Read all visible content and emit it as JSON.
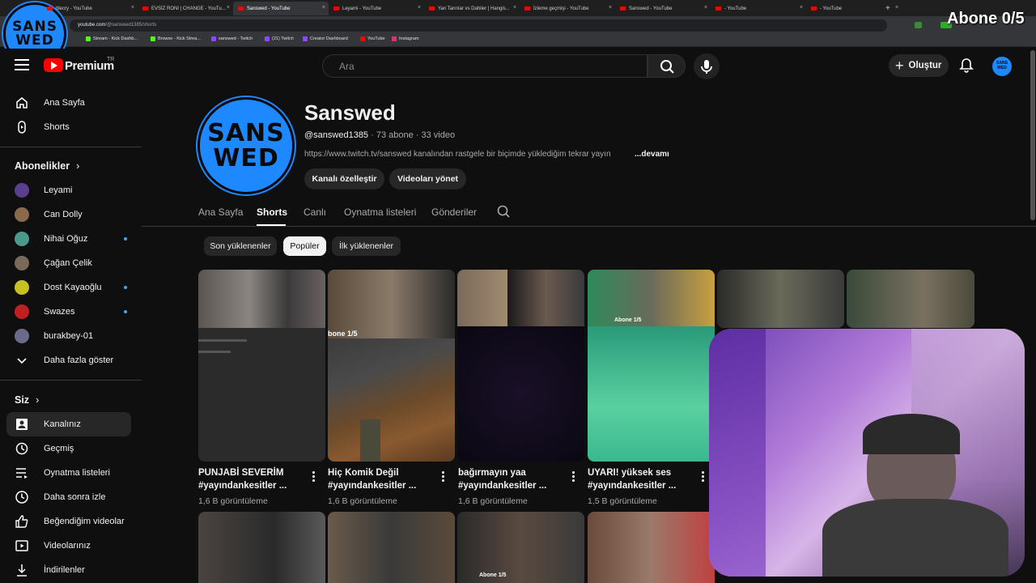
{
  "browser": {
    "tabs": [
      {
        "label": "ttlecry - YouTube",
        "active": false
      },
      {
        "label": "EVSİZ RONI | CHANGE - YouTu...",
        "active": false
      },
      {
        "label": "Sanswed - YouTube",
        "active": true
      },
      {
        "label": "Leyami - YouTube",
        "active": false
      },
      {
        "label": "Yan Tanrılar vs Dahiler | Hangis...",
        "active": false
      },
      {
        "label": "İzleme geçmişi - YouTube",
        "active": false
      },
      {
        "label": "Sanswed - YouTube",
        "active": false
      },
      {
        "label": "- YouTube",
        "active": false
      },
      {
        "label": "- YouTube",
        "active": false
      }
    ],
    "url_host": "youtube.com",
    "url_path": "/@sanswed1385/shorts",
    "bookmarks": [
      {
        "label": "Stream - Kick Dashb...",
        "color": "#53fc18"
      },
      {
        "label": "Browse - Kick Strea...",
        "color": "#53fc18"
      },
      {
        "label": "sanswed - Twitch",
        "color": "#9146ff"
      },
      {
        "label": "(21) Twitch",
        "color": "#9146ff"
      },
      {
        "label": "Creator Dashboard",
        "color": "#9146ff"
      },
      {
        "label": "YouTube",
        "color": "#ff0000"
      },
      {
        "label": "Instagram",
        "color": "#e1306c"
      }
    ]
  },
  "overlay": {
    "logo_line1": "SANS",
    "logo_line2": "WED",
    "abone_counter": "Abone 0/5"
  },
  "header": {
    "brand": "Premium",
    "region": "TR",
    "search_placeholder": "Ara",
    "create_label": "Oluştur",
    "avatar_line1": "SANS",
    "avatar_line2": "WED"
  },
  "sidebar": {
    "main": [
      {
        "label": "Ana Sayfa",
        "icon": "home-icon"
      },
      {
        "label": "Shorts",
        "icon": "shorts-icon"
      }
    ],
    "subs_heading": "Abonelikler",
    "subscriptions": [
      {
        "label": "Leyami",
        "color": "#5b3f8f",
        "dot": false
      },
      {
        "label": "Can Dolly",
        "color": "#8a6a4a",
        "dot": false
      },
      {
        "label": "Nihai Oğuz",
        "color": "#4a9a8a",
        "dot": true
      },
      {
        "label": "Çağan Çelik",
        "color": "#7a6a5a",
        "dot": false
      },
      {
        "label": "Dost Kayaoğlu",
        "color": "#c8c020",
        "dot": true
      },
      {
        "label": "Swazes",
        "color": "#c02020",
        "dot": true
      },
      {
        "label": "burakbey-01",
        "color": "#6a6a8a",
        "dot": false
      }
    ],
    "show_more": "Daha fazla göster",
    "you_heading": "Siz",
    "you_items": [
      {
        "label": "Kanalınız",
        "icon": "channel-icon",
        "selected": true
      },
      {
        "label": "Geçmiş",
        "icon": "history-icon",
        "selected": false
      },
      {
        "label": "Oynatma listeleri",
        "icon": "playlists-icon",
        "selected": false
      },
      {
        "label": "Daha sonra izle",
        "icon": "watch-later-icon",
        "selected": false
      },
      {
        "label": "Beğendiğim videolar",
        "icon": "like-icon",
        "selected": false
      },
      {
        "label": "Videolarınız",
        "icon": "your-videos-icon",
        "selected": false
      },
      {
        "label": "İndirilenler",
        "icon": "download-icon",
        "selected": false
      }
    ]
  },
  "channel": {
    "avatar_line1": "SANS",
    "avatar_line2": "WED",
    "name": "Sanswed",
    "handle": "@sanswed1385",
    "subs": "73 abone",
    "videos": "33 video",
    "description": "https://www.twitch.tv/sanswed kanalından rastgele bir biçimde yüklediğim tekrar yayın",
    "more": "...devamı",
    "customize_label": "Kanalı özelleştir",
    "manage_label": "Videoları yönet",
    "tabs": [
      {
        "label": "Ana Sayfa",
        "active": false
      },
      {
        "label": "Shorts",
        "active": true
      },
      {
        "label": "Canlı",
        "active": false
      },
      {
        "label": "Oynatma listeleri",
        "active": false
      },
      {
        "label": "Gönderiler",
        "active": false
      }
    ],
    "chips": [
      {
        "label": "Son yüklenenler",
        "selected": false
      },
      {
        "label": "Popüler",
        "selected": true
      },
      {
        "label": "İlk yüklenenler",
        "selected": false
      }
    ]
  },
  "shorts": [
    {
      "title1": "PUNJABİ SEVERİM",
      "title2": "#yayındankesitler ...",
      "views": "1,6 B görüntüleme"
    },
    {
      "title1": "Hiç Komik Değil",
      "title2": "#yayındankesitler ...",
      "views": "1,6 B görüntüleme"
    },
    {
      "title1": "bağırmayın yaa",
      "title2": "#yayındankesitler ...",
      "views": "1,6 B görüntüleme"
    },
    {
      "title1": "UYARI! yüksek ses",
      "title2": "#yayındankesitler ...",
      "views": "1,5 B görüntüleme"
    }
  ],
  "thumb_badges": {
    "abone_1": "Abone 1/5",
    "abone_2": "Abone 1/5",
    "abone_3": "Abone 1/5",
    "partial": "bone 1/5"
  }
}
